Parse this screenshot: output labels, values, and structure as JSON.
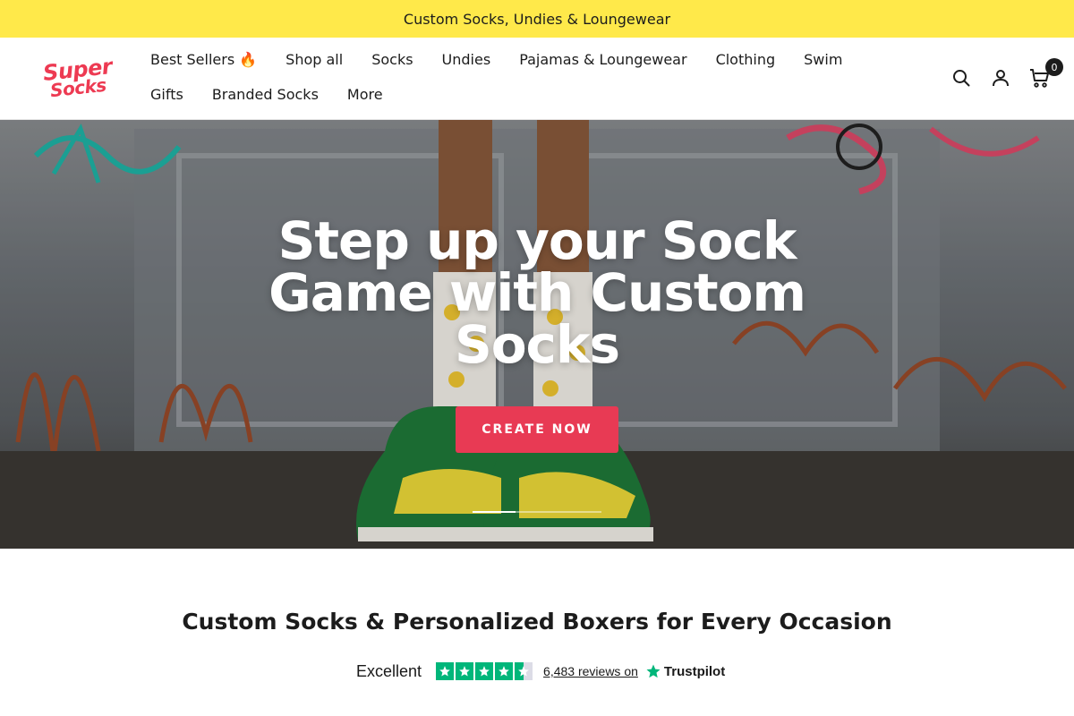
{
  "announcement": {
    "text": "Custom Socks, Undies & Loungewear"
  },
  "header": {
    "logo": {
      "line1": "Super",
      "line2": "Socks"
    },
    "nav_row1": [
      "Best Sellers 🔥",
      "Shop all",
      "Socks",
      "Undies",
      "Pajamas & Loungewear",
      "Clothing",
      "Swim"
    ],
    "nav_row2": [
      "Gifts",
      "Branded Socks",
      "More"
    ],
    "icons": {
      "search": "search-icon",
      "account": "user-icon",
      "cart": "cart-icon"
    },
    "cart_count": "0"
  },
  "hero": {
    "title": "Step up your Sock Game with Custom Socks",
    "cta_label": "CREATE NOW",
    "slider_progress": 0.33
  },
  "section": {
    "title": "Custom Socks & Personalized Boxers for Every Occasion"
  },
  "trustpilot": {
    "rating_label": "Excellent",
    "stars": 4.5,
    "reviews_text": "6,483 reviews on",
    "brand": "Trustpilot"
  },
  "colors": {
    "announcement_bg": "#ffe94a",
    "cta_bg": "#e83a54",
    "logo": "#ed3a52",
    "trustpilot_green": "#00b67a"
  }
}
